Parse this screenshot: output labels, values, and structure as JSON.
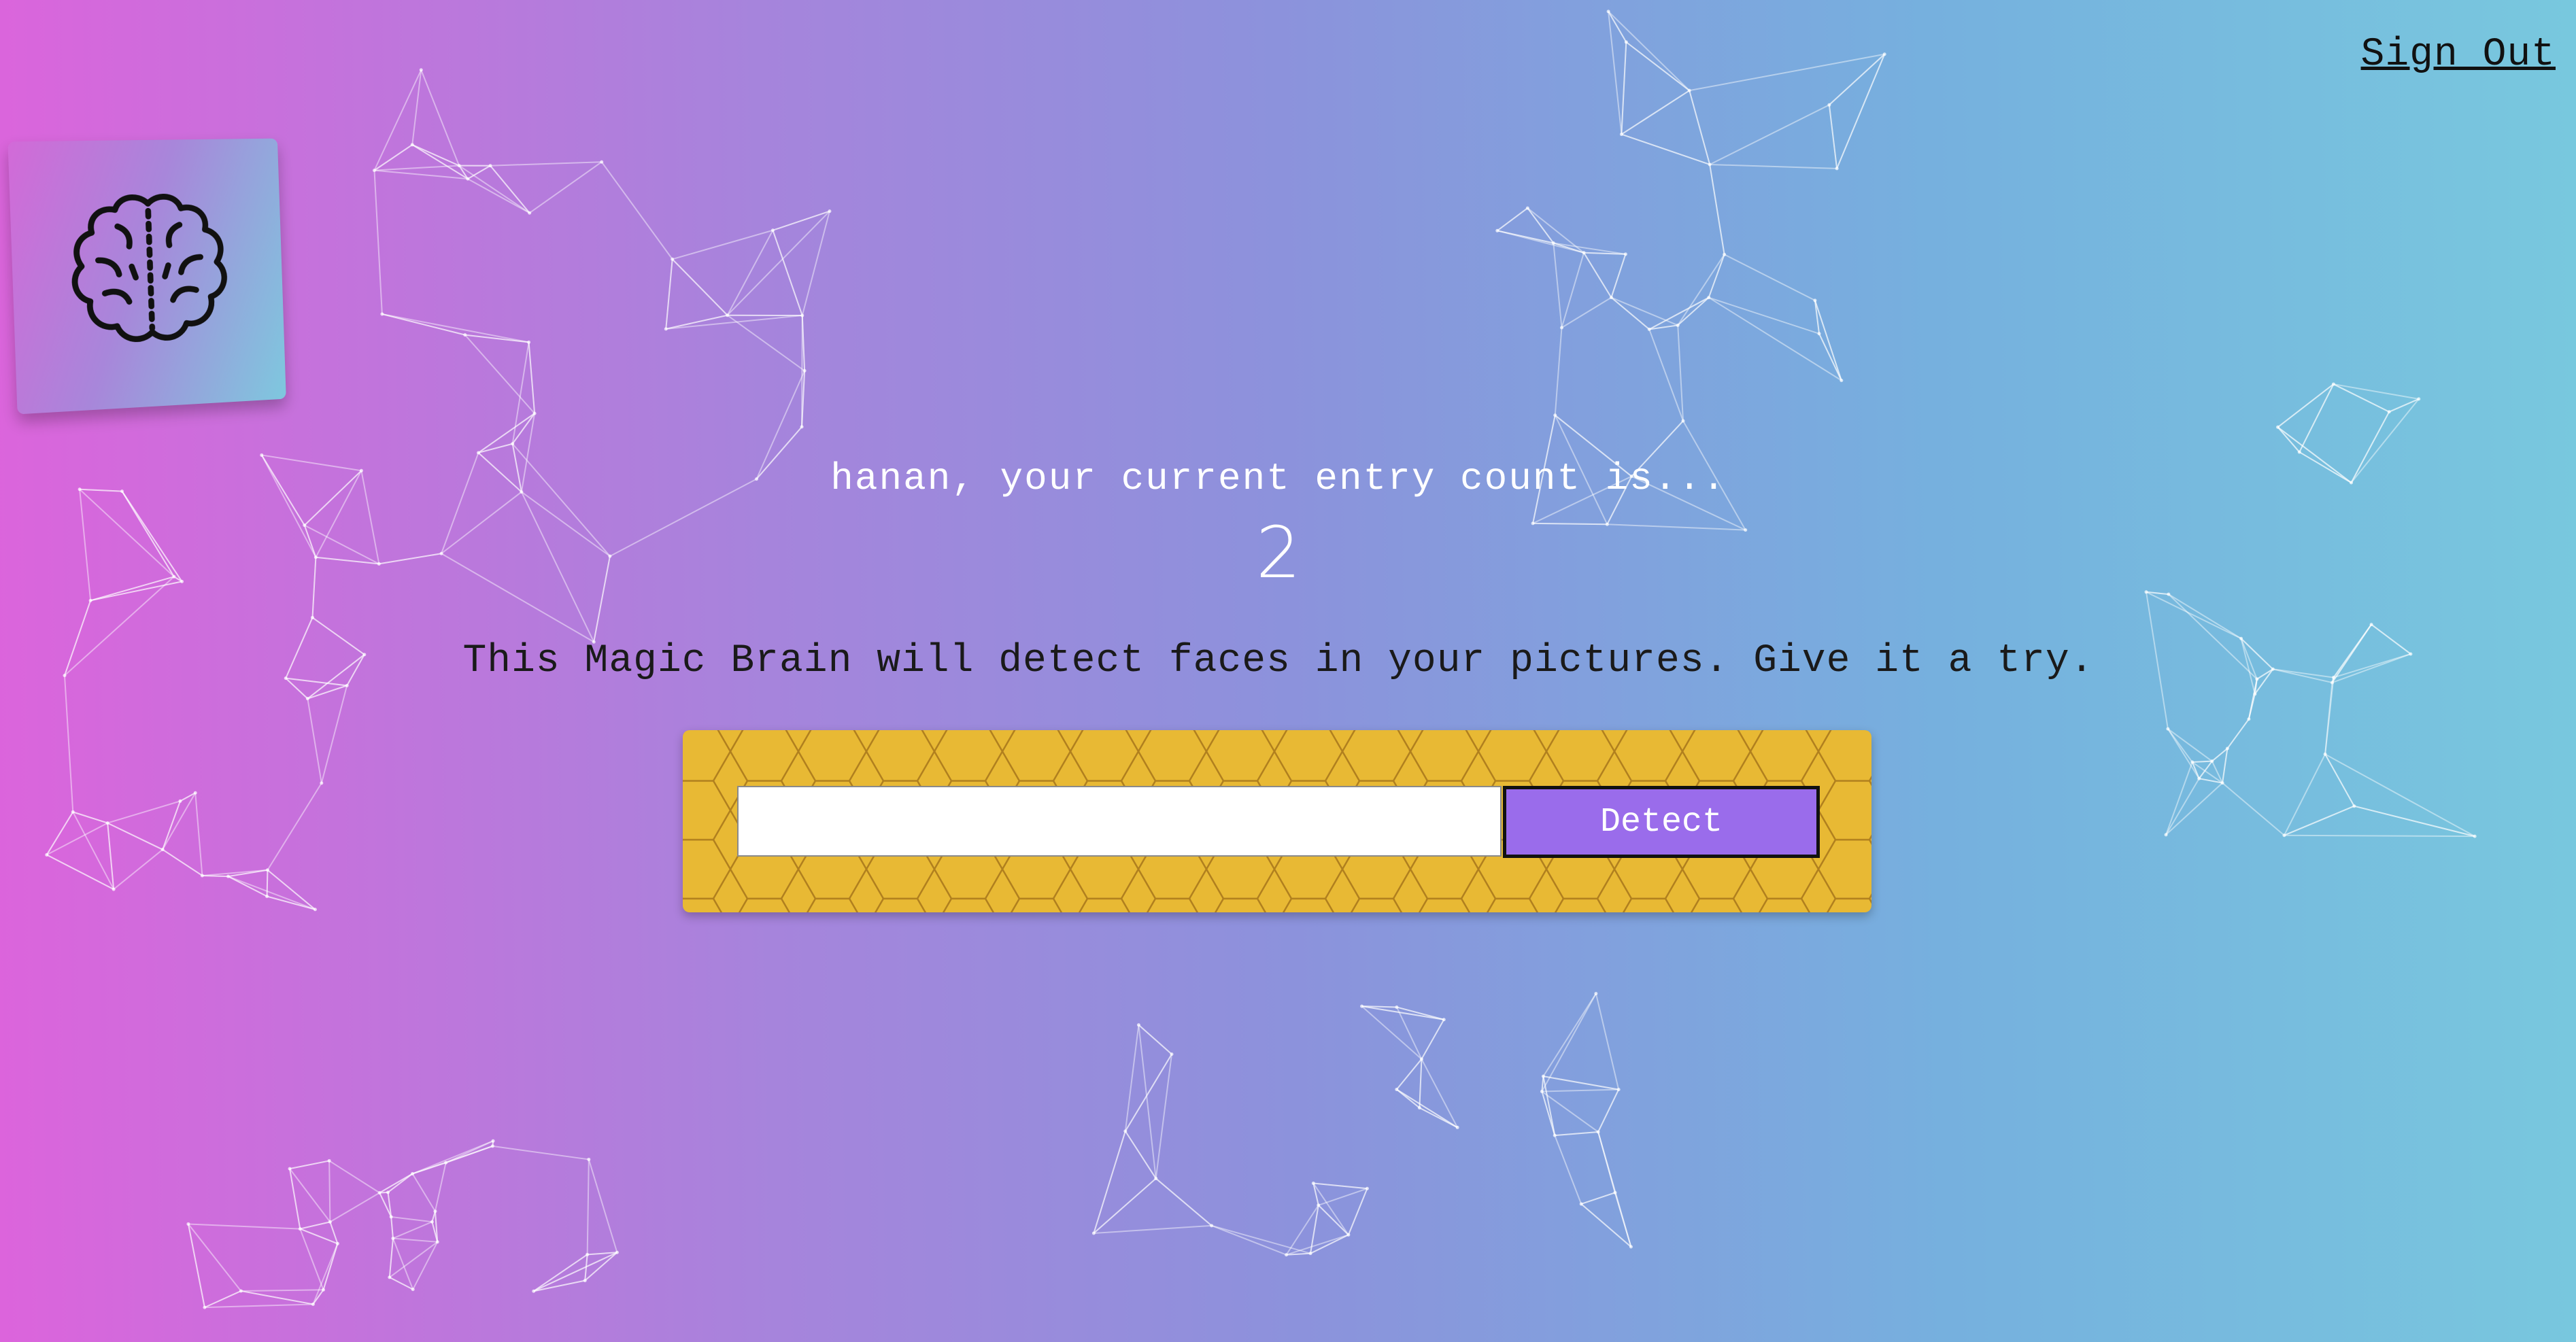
{
  "nav": {
    "sign_out_label": "Sign Out"
  },
  "logo": {
    "icon": "brain-icon"
  },
  "rank": {
    "message": "hanan, your current entry count is...",
    "count": "2"
  },
  "image_link_form": {
    "description": "This Magic Brain will detect faces in your pictures. Give it a try.",
    "url_input": {
      "value": "",
      "placeholder": ""
    },
    "detect_label": "Detect"
  },
  "colors": {
    "gradient_left": "#dc64dc",
    "gradient_right": "#78c8de",
    "panel": "#e8b934",
    "button": "#9a6ceb"
  }
}
